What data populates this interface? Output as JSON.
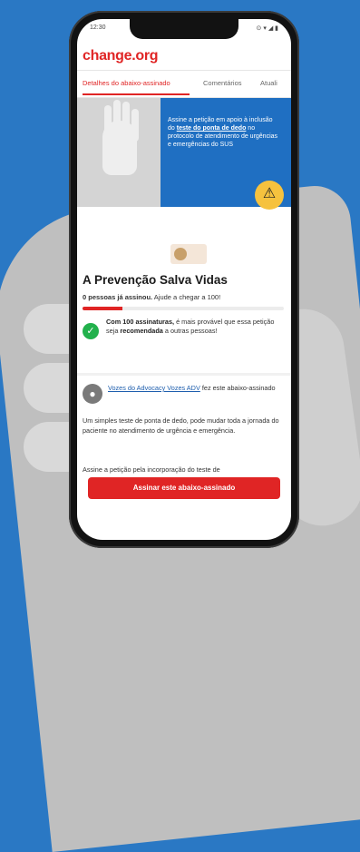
{
  "status_bar": {
    "time": "12:30",
    "icons": "⊙ ▾ ◢ ▮"
  },
  "app": {
    "logo": "change.org"
  },
  "tabs": [
    {
      "label": "Detalhes do abaixo-assinado",
      "active": true
    },
    {
      "label": "Comentários",
      "active": false
    },
    {
      "label": "Atuali",
      "active": false
    }
  ],
  "banner": {
    "text_before": "Assine a petição em apoio à inclusão do ",
    "text_bold": "teste do ponta de dedo",
    "text_after": " no protocolo de atendimento de urgências e emergências do SUS",
    "icon": "warning-icon"
  },
  "petition": {
    "title": "A Prevenção Salva Vidas",
    "signers_bold": "0 pessoas já assinou.",
    "signers_rest": " Ajude a chegar a 100!",
    "progress_fraction": 0.2,
    "note_bold1": "Com 100 assinaturas,",
    "note_text1": " é mais provável que essa petição seja ",
    "note_bold2": "recomendada",
    "note_text2": " a outras pessoas!",
    "author_link": "Vozes do Advocacy Vozes ADV",
    "author_rest": " fez este abaixo-assinado",
    "description": "Um simples teste de ponta de dedo, pode mudar toda a jornada do paciente no atendimento de urgência e emergência.",
    "description2": "Assine a petição pela incorporação do teste de",
    "cta": "Assinar este abaixo-assinado"
  },
  "colors": {
    "brand": "#e02525",
    "background": "#2a78c4",
    "banner_blue": "#1f6fc2",
    "success": "#22b14c"
  }
}
